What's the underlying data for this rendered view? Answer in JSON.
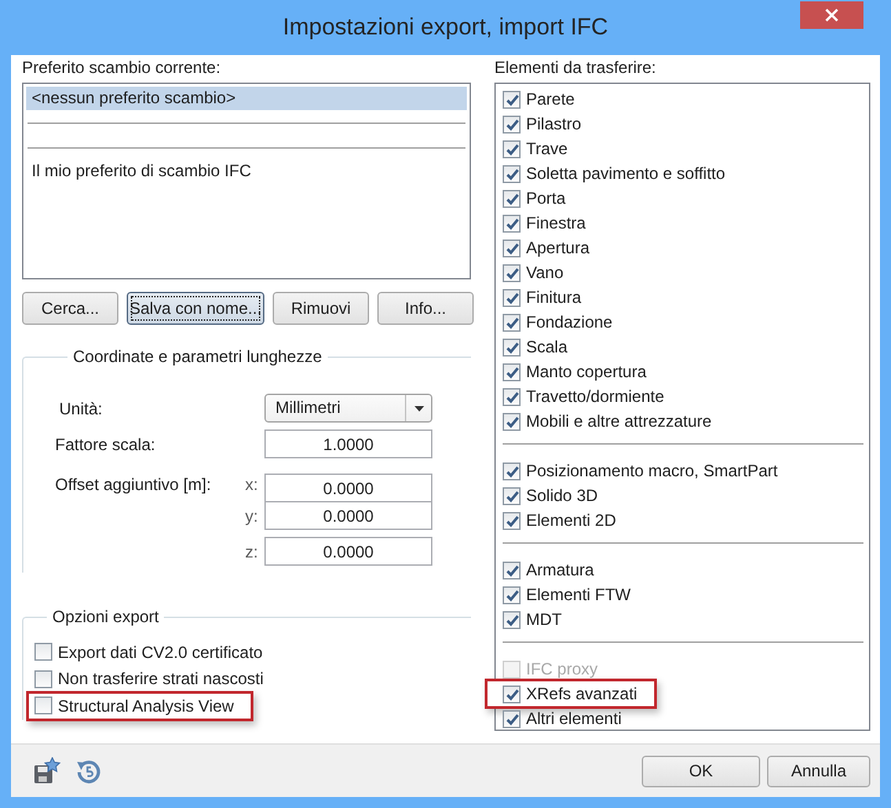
{
  "window": {
    "title": "Impostazioni export, import IFC"
  },
  "favorites": {
    "label": "Preferito scambio corrente:",
    "items": [
      {
        "kind": "entry",
        "text": "<nessun preferito scambio>",
        "selected": true
      },
      {
        "kind": "separator"
      },
      {
        "kind": "separator"
      },
      {
        "kind": "entry",
        "text": "Il mio preferito di scambio IFC",
        "selected": false
      }
    ],
    "buttons": [
      {
        "label": "Cerca...",
        "focused": false
      },
      {
        "label": "Salva con nome...",
        "focused": true
      },
      {
        "label": "Rimuovi",
        "focused": false
      },
      {
        "label": "Info...",
        "focused": false
      }
    ]
  },
  "coordinates": {
    "title": "Coordinate e parametri lunghezze",
    "unit": {
      "label": "Unità:",
      "value": "Millimetri"
    },
    "scale": {
      "label": "Fattore scala:",
      "value": "1.0000"
    },
    "offset": {
      "label": "Offset aggiuntivo [m]:",
      "axes": [
        {
          "axis": "x:",
          "value": "0.0000"
        },
        {
          "axis": "y:",
          "value": "0.0000"
        },
        {
          "axis": "z:",
          "value": "0.0000"
        }
      ]
    }
  },
  "export_options": {
    "title": "Opzioni export",
    "options": [
      {
        "label": "Export dati CV2.0 certificato",
        "checked": false,
        "highlighted": false
      },
      {
        "label": "Non trasferire strati nascosti",
        "checked": false,
        "highlighted": false
      },
      {
        "label": "Structural Analysis View",
        "checked": false,
        "highlighted": true
      }
    ]
  },
  "elements": {
    "label": "Elementi da trasferire:",
    "groups": [
      {
        "items": [
          {
            "label": "Parete",
            "checked": true,
            "disabled": false,
            "highlighted": false
          },
          {
            "label": "Pilastro",
            "checked": true,
            "disabled": false,
            "highlighted": false
          },
          {
            "label": "Trave",
            "checked": true,
            "disabled": false,
            "highlighted": false
          },
          {
            "label": "Soletta pavimento e soffitto",
            "checked": true,
            "disabled": false,
            "highlighted": false
          },
          {
            "label": "Porta",
            "checked": true,
            "disabled": false,
            "highlighted": false
          },
          {
            "label": "Finestra",
            "checked": true,
            "disabled": false,
            "highlighted": false
          },
          {
            "label": "Apertura",
            "checked": true,
            "disabled": false,
            "highlighted": false
          },
          {
            "label": "Vano",
            "checked": true,
            "disabled": false,
            "highlighted": false
          },
          {
            "label": "Finitura",
            "checked": true,
            "disabled": false,
            "highlighted": false
          },
          {
            "label": "Fondazione",
            "checked": true,
            "disabled": false,
            "highlighted": false
          },
          {
            "label": "Scala",
            "checked": true,
            "disabled": false,
            "highlighted": false
          },
          {
            "label": "Manto copertura",
            "checked": true,
            "disabled": false,
            "highlighted": false
          },
          {
            "label": "Travetto/dormiente",
            "checked": true,
            "disabled": false,
            "highlighted": false
          },
          {
            "label": "Mobili e altre attrezzature",
            "checked": true,
            "disabled": false,
            "highlighted": false
          }
        ]
      },
      {
        "items": [
          {
            "label": "Posizionamento macro, SmartPart",
            "checked": true,
            "disabled": false,
            "highlighted": false
          },
          {
            "label": "Solido 3D",
            "checked": true,
            "disabled": false,
            "highlighted": false
          },
          {
            "label": "Elementi 2D",
            "checked": true,
            "disabled": false,
            "highlighted": false
          }
        ]
      },
      {
        "items": [
          {
            "label": "Armatura",
            "checked": true,
            "disabled": false,
            "highlighted": false
          },
          {
            "label": "Elementi FTW",
            "checked": true,
            "disabled": false,
            "highlighted": false
          },
          {
            "label": "MDT",
            "checked": true,
            "disabled": false,
            "highlighted": false
          }
        ]
      },
      {
        "items": [
          {
            "label": "IFC proxy",
            "checked": false,
            "disabled": true,
            "highlighted": false
          },
          {
            "label": "XRefs avanzati",
            "checked": true,
            "disabled": false,
            "highlighted": true
          },
          {
            "label": "Altri elementi",
            "checked": true,
            "disabled": false,
            "highlighted": false
          }
        ]
      }
    ]
  },
  "footer": {
    "buttons": [
      {
        "label": "OK"
      },
      {
        "label": "Annulla"
      }
    ]
  }
}
